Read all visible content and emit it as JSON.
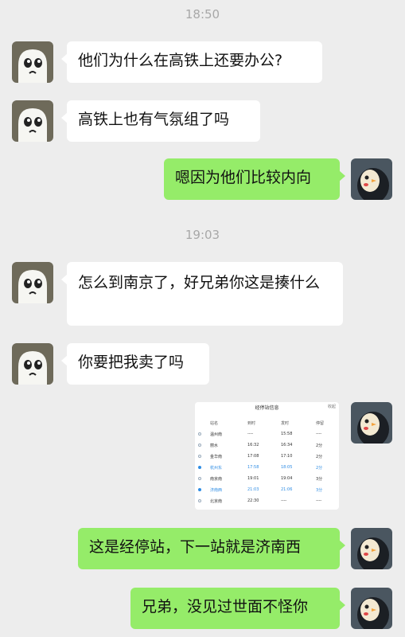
{
  "timestamps": [
    "18:50",
    "19:03"
  ],
  "messages": [
    {
      "side": "in",
      "text": "他们为什么在高铁上还要办公?"
    },
    {
      "side": "in",
      "text": "高铁上也有气氛组了吗"
    },
    {
      "side": "out",
      "text": "嗯因为他们比较内向"
    },
    {
      "side": "in",
      "text": "怎么到南京了，好兄弟你这是揍什么"
    },
    {
      "side": "in",
      "text": "你要把我卖了吗"
    },
    {
      "side": "out",
      "text": "这是经停站，下一站就是济南西"
    },
    {
      "side": "out",
      "text": "兄弟，没见过世面不怪你"
    }
  ],
  "stop_info": {
    "title": "经停站信息",
    "close": "收起",
    "headers": [
      "站名",
      "到时",
      "发时",
      "停留"
    ],
    "rows": [
      {
        "station": "温州南",
        "arrive": "----",
        "depart": "15:58",
        "stay": "----",
        "highlight": false
      },
      {
        "station": "丽水",
        "arrive": "16:32",
        "depart": "16:34",
        "stay": "2分",
        "highlight": false
      },
      {
        "station": "金华南",
        "arrive": "17:08",
        "depart": "17:10",
        "stay": "2分",
        "highlight": false
      },
      {
        "station": "杭州东",
        "arrive": "17:58",
        "depart": "18:05",
        "stay": "2分",
        "highlight": true
      },
      {
        "station": "南京南",
        "arrive": "19:01",
        "depart": "19:04",
        "stay": "3分",
        "highlight": false
      },
      {
        "station": "济南西",
        "arrive": "21:03",
        "depart": "21:06",
        "stay": "3分",
        "highlight": true
      },
      {
        "station": "北京南",
        "arrive": "22:30",
        "depart": "----",
        "stay": "----",
        "highlight": false
      }
    ]
  },
  "colors": {
    "background": "#ededed",
    "incoming_bubble": "#ffffff",
    "outgoing_bubble": "#95ec69",
    "highlight": "#2f8de4"
  },
  "icons": {
    "friend_avatar": "ghost-avatar-icon",
    "self_avatar": "penguin-avatar-icon"
  }
}
